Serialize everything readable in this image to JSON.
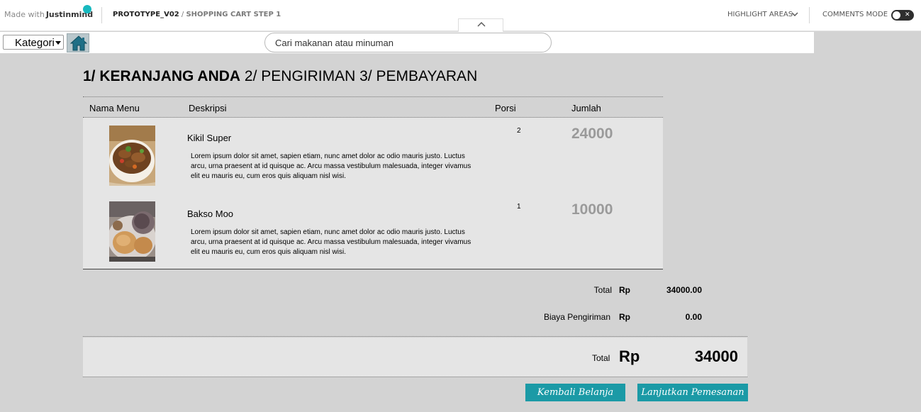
{
  "topbar": {
    "made_with": "Made with",
    "brand": "Justinmind",
    "project": "PROTOTYPE_V02",
    "separator": " / ",
    "page": "SHOPPING CART STEP 1",
    "highlight_label": "HIGHLIGHT AREAS",
    "comments_label": "COMMENTS MODE",
    "toggle_glyph": "✕",
    "accent": "#17b9bf"
  },
  "appbar": {
    "category_label": "Kategori",
    "search_placeholder": "Cari makanan atau minuman"
  },
  "steps": {
    "step1": "1/ KERANJANG ANDA",
    "step2": " 2/ PENGIRIMAN",
    "step3": " 3/ PEMBAYARAN"
  },
  "table": {
    "headers": [
      "Nama Menu",
      "Deskripsi",
      "Porsi",
      "Jumlah"
    ],
    "items": [
      {
        "name": "Kikil Super",
        "description": "Lorem ipsum dolor sit amet, sapien etiam, nunc amet dolor ac odio mauris justo. Luctus arcu, urna praesent at id quisque ac. Arcu massa vestibulum malesuada, integer vivamus elit eu mauris eu, cum eros quis aliquam nisl wisi.",
        "qty": "2",
        "amount": "24000"
      },
      {
        "name": "Bakso Moo",
        "description": "Lorem ipsum dolor sit amet, sapien etiam, nunc amet dolor ac odio mauris justo. Luctus arcu, urna praesent at id quisque ac. Arcu massa vestibulum malesuada, integer vivamus elit eu mauris eu, cum eros quis aliquam nisl wisi.",
        "qty": "1",
        "amount": "10000"
      }
    ]
  },
  "summary": {
    "subtotal_label": "Total",
    "currency": "Rp",
    "subtotal_value": "34000.00",
    "shipping_label": "Biaya Pengiriman",
    "shipping_value": "0.00",
    "grand_label": "Total",
    "grand_value": "34000"
  },
  "actions": {
    "back_label": "Kembali Belanja",
    "continue_label": "Lanjutkan Pemesanan",
    "button_color": "#1b9aa6"
  }
}
